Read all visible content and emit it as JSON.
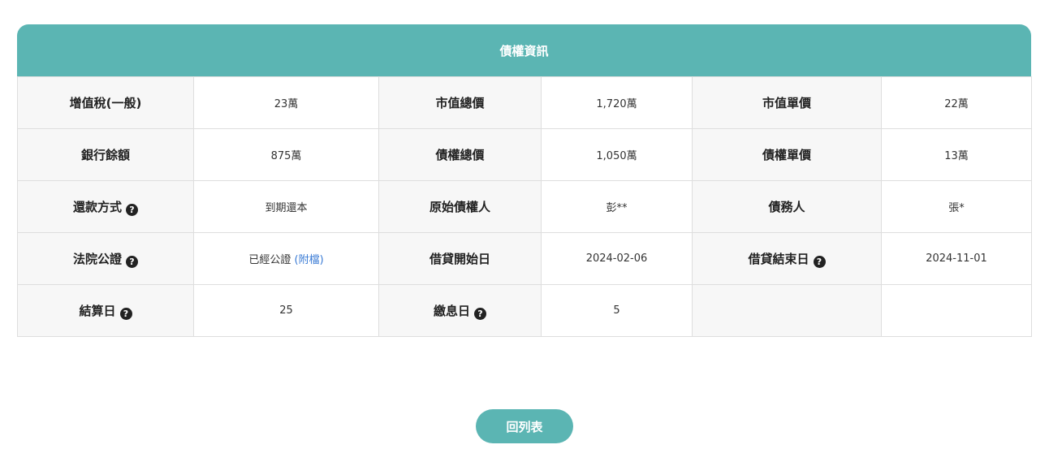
{
  "panel": {
    "title": "債權資訊"
  },
  "rows": [
    {
      "c1_label": "增值稅(一般)",
      "c1_value": "23萬",
      "c2_label": "市值總價",
      "c2_value": "1,720萬",
      "c3_label": "市值單價",
      "c3_value": "22萬"
    },
    {
      "c1_label": "銀行餘額",
      "c1_value": "875萬",
      "c2_label": "債權總價",
      "c2_value": "1,050萬",
      "c3_label": "債權單價",
      "c3_value": "13萬"
    },
    {
      "c1_label": "還款方式",
      "c1_value": "到期還本",
      "c2_label": "原始債權人",
      "c2_value": "彭**",
      "c3_label": "債務人",
      "c3_value": "張*"
    },
    {
      "c1_label": "法院公證",
      "c1_value": "已經公證",
      "c1_link": "(附檔)",
      "c2_label": "借貸開始日",
      "c2_value": "2024-02-06",
      "c3_label": "借貸結束日",
      "c3_value": "2024-11-01"
    },
    {
      "c1_label": "結算日",
      "c1_value": "25",
      "c2_label": "繳息日",
      "c2_value": "5"
    }
  ],
  "help_icon_glyph": "?",
  "footer": {
    "back_label": "回列表"
  },
  "colors": {
    "accent": "#5bb5b3",
    "label_bg": "#f7f7f7",
    "link": "#3a7bd5"
  }
}
